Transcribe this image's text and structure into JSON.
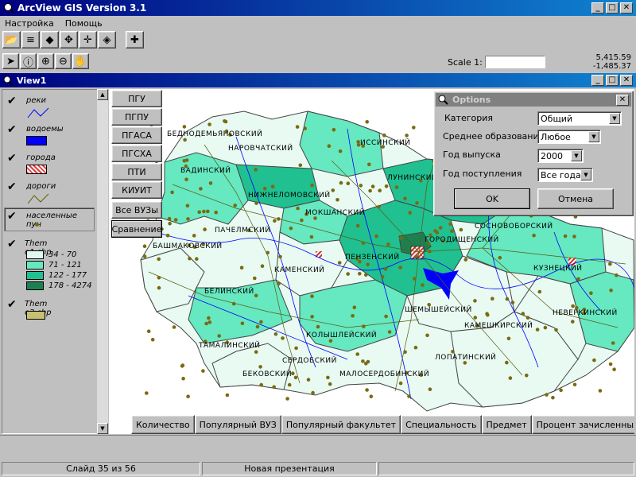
{
  "app": {
    "title": "ArcView GIS Version 3.1"
  },
  "menu": [
    {
      "label": "Настройка"
    },
    {
      "label": "Помощь"
    }
  ],
  "scale": {
    "label": "Scale 1:",
    "value": "",
    "x": "5,415.59",
    "y": "-1,485.37"
  },
  "view": {
    "title": "View1"
  },
  "legend": [
    {
      "label": "реки",
      "icon": "river-line-icon"
    },
    {
      "label": "водоемы",
      "icon": "water-fill-icon"
    },
    {
      "label": "города",
      "icon": "city-hatch-icon"
    },
    {
      "label": "дороги",
      "icon": "road-line-icon"
    },
    {
      "label": "населенные пун",
      "icon": "point-dot-icon"
    }
  ],
  "theme1": {
    "label": "Them e1.shp",
    "classes": [
      {
        "label": "34 - 70",
        "color": "#e0f8f0"
      },
      {
        "label": "71 - 121",
        "color": "#66e8c0"
      },
      {
        "label": "122 - 177",
        "color": "#20c090"
      },
      {
        "label": "178 - 4274",
        "color": "#1e8050"
      }
    ]
  },
  "theme2": {
    "label": "Them e2.shp",
    "color": "#c8c070"
  },
  "side_buttons": [
    {
      "label": "ПГУ"
    },
    {
      "label": "ПГПУ"
    },
    {
      "label": "ПГАСА"
    },
    {
      "label": "ПГСХА"
    },
    {
      "label": "ПТИ"
    },
    {
      "label": "КИУИТ"
    },
    {
      "label": "Все ВУЗы"
    },
    {
      "label": "Сравнение"
    }
  ],
  "map_labels": [
    {
      "text": "БЕДНОДЕМЬЯНОВСКИЙ"
    },
    {
      "text": "НАРОВЧАТСКИЙ"
    },
    {
      "text": "ИССИНСКИЙ"
    },
    {
      "text": "ВАДИНСКИЙ"
    },
    {
      "text": "ЛУНИНСКИЙ"
    },
    {
      "text": "НИЖНЕЛОМОВСКИЙ"
    },
    {
      "text": "МОКШАНСКИЙ"
    },
    {
      "text": "ПАЧЕЛМСКИЙ"
    },
    {
      "text": "СОСНОВОБОРСКИЙ"
    },
    {
      "text": "ГОРОДИЩЕНСКИЙ"
    },
    {
      "text": "БАШМАКОВСКИЙ"
    },
    {
      "text": "ПЕНЗЕНСКИЙ"
    },
    {
      "text": "КАМЕНСКИЙ"
    },
    {
      "text": "КУЗНЕЦКИЙ"
    },
    {
      "text": "БЕЛИНСКИЙ"
    },
    {
      "text": "НЕВЕРКИНСКИЙ"
    },
    {
      "text": "ШЕМЫШЕЙСКИЙ"
    },
    {
      "text": "КАМЕШКИРСКИЙ"
    },
    {
      "text": "КОЛЫШЛЕЙСКИЙ"
    },
    {
      "text": "ТАМАЛИНСКИЙ"
    },
    {
      "text": "СЕРДОБСКИЙ"
    },
    {
      "text": "ЛОПАТИНСКИЙ"
    },
    {
      "text": "БЕКОВСКИЙ"
    },
    {
      "text": "МАЛОСЕРДОБИНСКИЙ"
    }
  ],
  "bottom_tabs": [
    {
      "label": "Количество"
    },
    {
      "label": "Популярный ВУЗ"
    },
    {
      "label": "Популярный факультет"
    },
    {
      "label": "Специальность"
    },
    {
      "label": "Предмет"
    },
    {
      "label": "Процент зачисленных"
    }
  ],
  "options": {
    "title": "Options",
    "fields": [
      {
        "label": "Категория",
        "value": "Общий"
      },
      {
        "label": "Среднее образование",
        "value": "Любое"
      },
      {
        "label": "Год выпуска",
        "value": "2000"
      },
      {
        "label": "Год поступления",
        "value": "Все года"
      }
    ],
    "ok": "OK",
    "cancel": "Отмена"
  },
  "status": {
    "slide": "Слайд 35 из 56",
    "presentation": "Новая презентация"
  }
}
